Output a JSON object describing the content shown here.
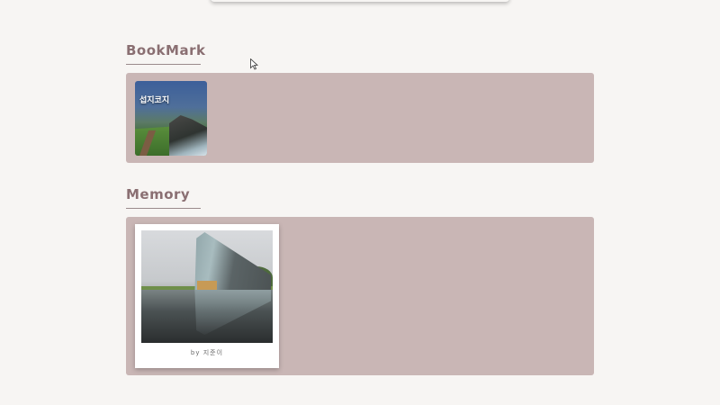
{
  "bookmark_section": {
    "title": "BookMark",
    "cards": [
      {
        "label": "섭지코지"
      }
    ]
  },
  "memory_section": {
    "title": "Memory",
    "photos": [
      {
        "caption": "by 지준이"
      }
    ]
  },
  "colors": {
    "background": "#f7f5f3",
    "panel": "#c9b6b5",
    "title_text": "#8a6f72"
  }
}
